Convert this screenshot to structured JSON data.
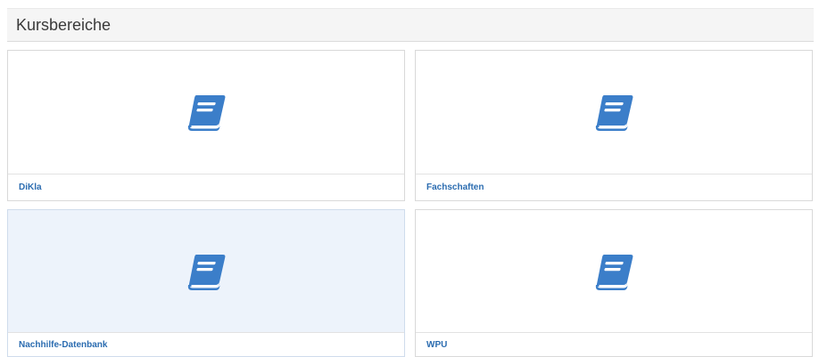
{
  "page": {
    "title": "Kursbereiche"
  },
  "icon": {
    "name": "book-icon",
    "color": "#3b7ec9"
  },
  "categories": [
    {
      "label": "DiKla"
    },
    {
      "label": "Fachschaften"
    },
    {
      "label": "Nachhilfe-Datenbank"
    },
    {
      "label": "WPU"
    }
  ]
}
